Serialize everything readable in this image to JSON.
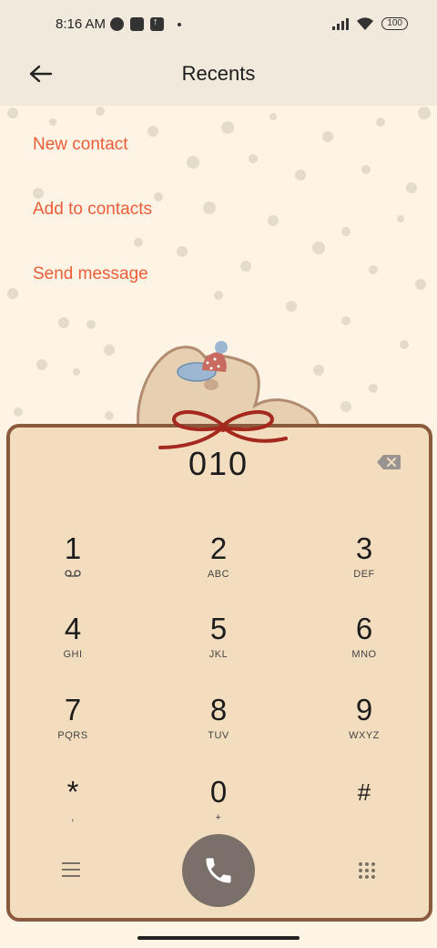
{
  "status_bar": {
    "time": "8:16 AM",
    "battery": "100"
  },
  "header": {
    "title": "Recents"
  },
  "actions": {
    "new_contact": "New contact",
    "add_to_contacts": "Add to contacts",
    "send_message": "Send message"
  },
  "dialer": {
    "number": "010",
    "keys": [
      {
        "digit": "1",
        "letters": "",
        "icon": "voicemail-icon"
      },
      {
        "digit": "2",
        "letters": "ABC"
      },
      {
        "digit": "3",
        "letters": "DEF"
      },
      {
        "digit": "4",
        "letters": "GHI"
      },
      {
        "digit": "5",
        "letters": "JKL"
      },
      {
        "digit": "6",
        "letters": "MNO"
      },
      {
        "digit": "7",
        "letters": "PQRS"
      },
      {
        "digit": "8",
        "letters": "TUV"
      },
      {
        "digit": "9",
        "letters": "WXYZ"
      },
      {
        "digit": "*",
        "letters": ","
      },
      {
        "digit": "0",
        "letters": "+"
      },
      {
        "digit": "#",
        "letters": ""
      }
    ]
  },
  "colors": {
    "accent": "#ec5e3a",
    "dialpad_bg": "#f3ddbf",
    "dialpad_border": "#8b5a3c",
    "call_button": "#7b7069"
  }
}
